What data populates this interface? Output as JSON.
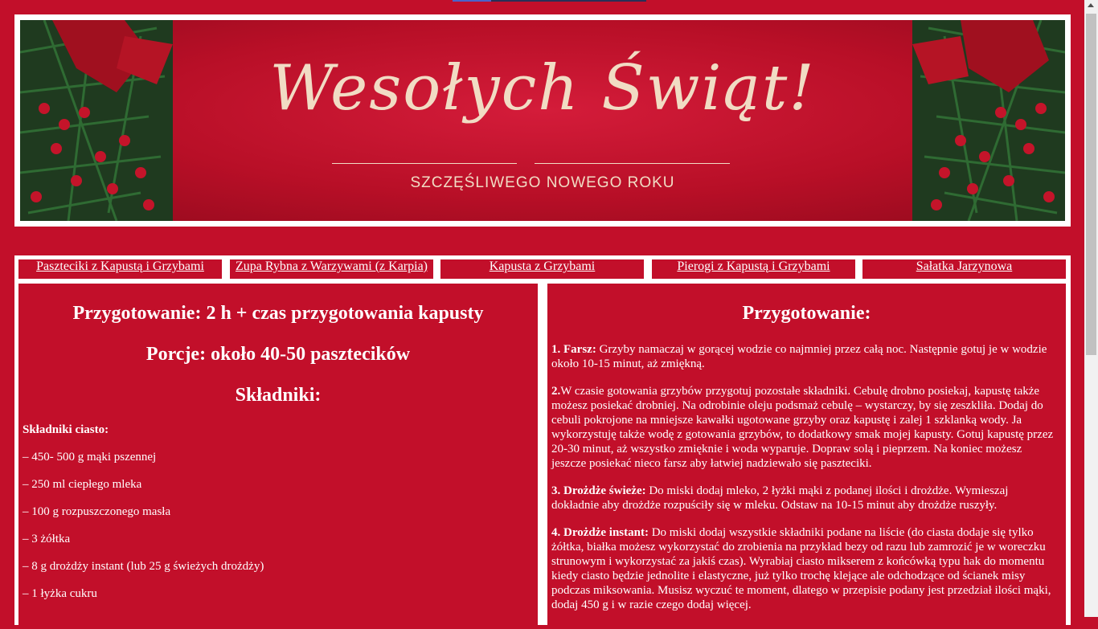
{
  "banner": {
    "title": "Wesołych Świąt!",
    "subtitle": "SZCZĘŚLIWEGO NOWEGO ROKU"
  },
  "nav": {
    "items": [
      "Paszteciki z Kapustą i Grzybami",
      "Zupa Rybna z Warzywami (z Karpia)",
      "Kapusta z Grzybami",
      "Pierogi z Kapustą i Grzybami",
      "Sałatka Jarzynowa"
    ]
  },
  "left": {
    "prep_time": "Przygotowanie: 2 h + czas przygotowania kapusty",
    "portions": "Porcje: około 40-50 pasztecików",
    "ingredients_title": "Składniki:",
    "dough_title": "Składniki ciasto:",
    "dough_items": [
      "– 450- 500 g mąki pszennej",
      "– 250 ml ciepłego mleka",
      "– 100 g rozpuszczonego masła",
      "– 3 żółtka",
      "– 8 g drożdży instant (lub 25 g świeżych drożdży)",
      "– 1 łyżka cukru"
    ]
  },
  "right": {
    "title": "Przygotowanie:",
    "steps": [
      {
        "label": "1. Farsz:",
        "text": " Grzyby namaczaj w gorącej wodzie co najmniej przez całą noc. Następnie gotuj je w wodzie około 10-15 minut, aż zmiękną."
      },
      {
        "label": "2.",
        "text": "W czasie gotowania grzybów przygotuj pozostałe składniki. Cebulę drobno posiekaj, kapustę także możesz posiekać drobniej. Na odrobinie oleju podsmaż cebulę – wystarczy, by się zeszkliła. Dodaj do cebuli pokrojone na mniejsze kawałki ugotowane grzyby oraz kapustę i zalej 1 szklanką wody. Ja wykorzystuję także wodę z gotowania grzybów, to dodatkowy smak mojej kapusty. Gotuj kapustę przez 20-30 minut, aż wszystko zmięknie i woda wyparuje. Dopraw solą i pieprzem. Na koniec możesz jeszcze posiekać nieco farsz aby łatwiej nadziewało się paszteciki."
      },
      {
        "label": "3. Drożdże świeże:",
        "text": " Do miski dodaj mleko, 2 łyżki mąki z podanej ilości i drożdże. Wymieszaj dokładnie aby drożdże rozpuściły się w mleku. Odstaw na 10-15 minut aby drożdże ruszyły."
      },
      {
        "label": "4. Drożdże instant:",
        "text": " Do miski dodaj wszystkie składniki podane na liście (do ciasta dodaje się tylko żółtka, białka możesz wykorzystać do zrobienia na przykład bezy od razu lub zamrozić je w woreczku strunowym i wykorzystać za jakiś czas). Wyrabiaj ciasto mikserem z końcówką typu hak do momentu kiedy ciasto będzie jednolite i elastyczne, już tylko trochę klejące ale odchodzące od ścianek misy podczas miksowania. Musisz wyczuć te moment, dlatego w przepisie podany jest przedział ilości mąki, dodaj 450 g i w razie czego dodaj więcej."
      }
    ]
  }
}
